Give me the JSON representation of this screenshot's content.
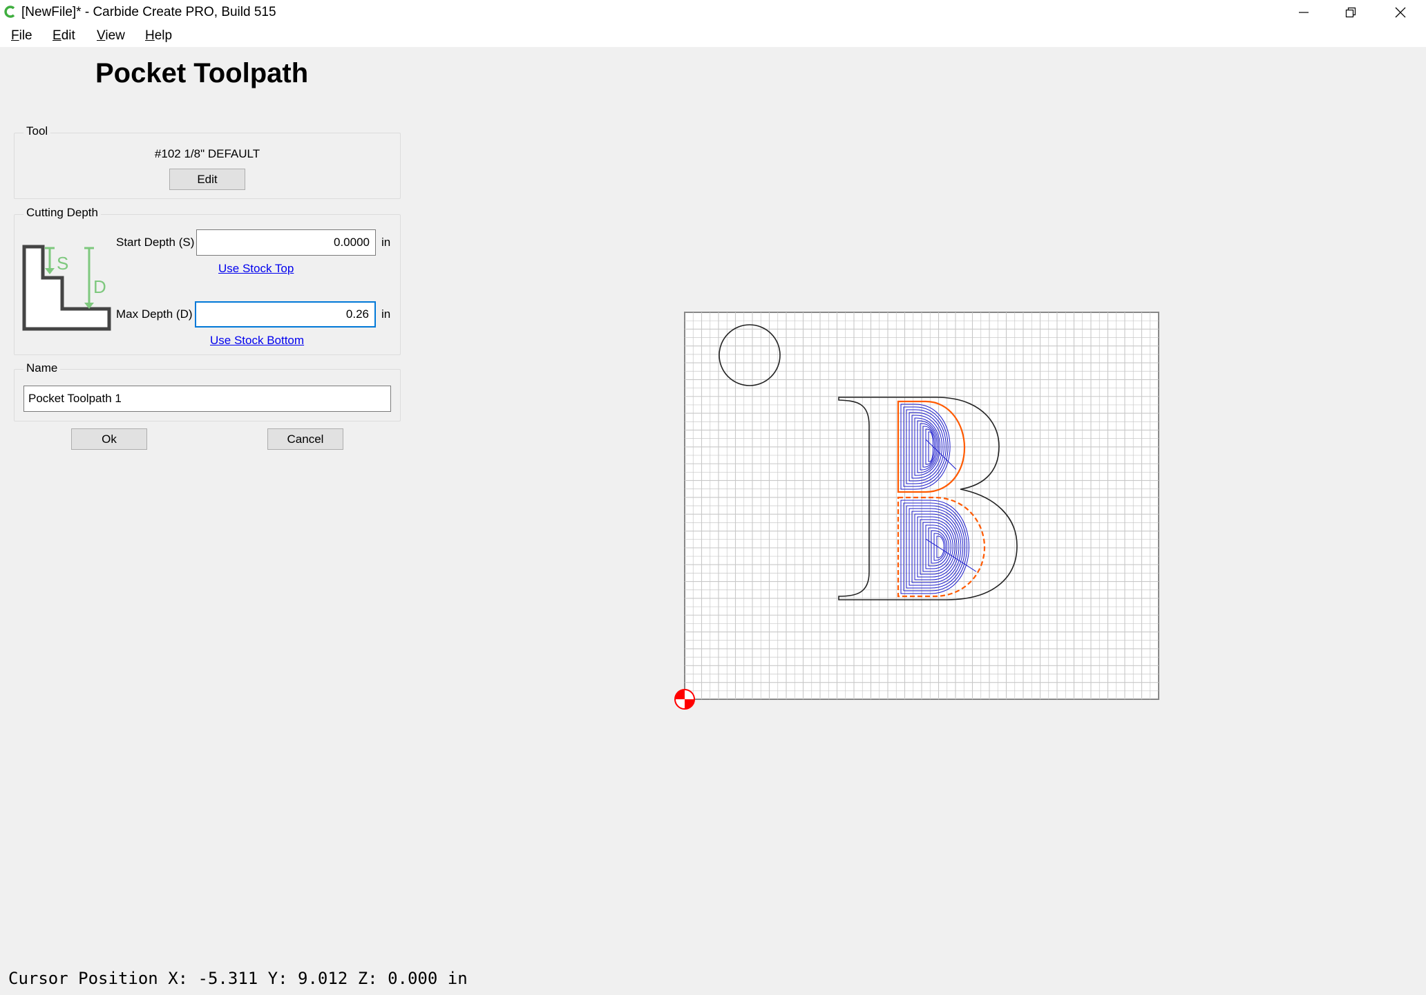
{
  "window": {
    "title": "[NewFile]* - Carbide Create PRO, Build 515",
    "icon": "carbide-logo-icon",
    "controls": [
      "minimize-icon",
      "restore-icon",
      "close-icon"
    ]
  },
  "menu": {
    "items": [
      {
        "label": "File",
        "mnemonic": "F",
        "rest": "ile"
      },
      {
        "label": "Edit",
        "mnemonic": "E",
        "rest": "dit"
      },
      {
        "label": "View",
        "mnemonic": "V",
        "rest": "iew"
      },
      {
        "label": "Help",
        "mnemonic": "H",
        "rest": "elp"
      }
    ]
  },
  "dialog": {
    "title": "Pocket Toolpath",
    "tool": {
      "group_label": "Tool",
      "name": "#102 1/8\" DEFAULT",
      "edit_label": "Edit"
    },
    "cutting_depth": {
      "group_label": "Cutting Depth",
      "start_label": "Start Depth (S)",
      "start_value": "0.0000",
      "start_unit": "in",
      "use_stock_top": "Use Stock Top",
      "max_label": "Max Depth (D)",
      "max_value": "0.26",
      "max_unit": "in",
      "use_stock_bottom": "Use Stock Bottom",
      "diagram_s": "S",
      "diagram_d": "D"
    },
    "name": {
      "group_label": "Name",
      "value": "Pocket Toolpath 1"
    },
    "ok_label": "Ok",
    "cancel_label": "Cancel"
  },
  "canvas": {
    "grid_color": "#c8c8c8",
    "outline_color": "#222222",
    "toolpath_color": "#1a1acc",
    "boundary_color": "#ff5a00",
    "origin_color": "#ff0000",
    "grid_cols": 28,
    "grid_rows": 23,
    "pocket_top_offsets": 12,
    "pocket_bottom_offsets": 15
  },
  "status": {
    "text": "Cursor Position X: -5.311 Y: 9.012 Z: 0.000 in"
  }
}
